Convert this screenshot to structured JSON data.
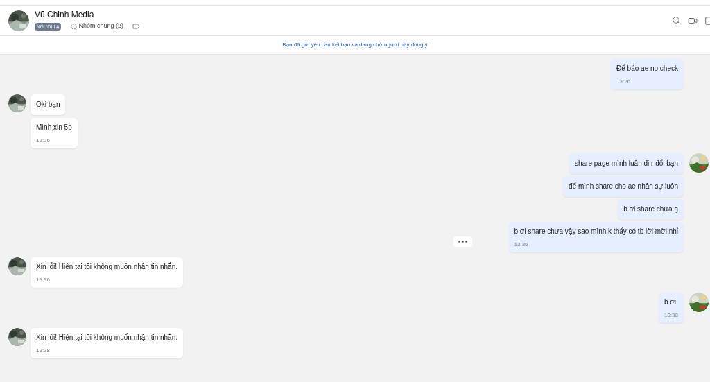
{
  "header": {
    "name": "Vũ Chinh Media",
    "badge": "NGƯỜI LẠ",
    "common_groups": "Nhóm chung (2)"
  },
  "notice": "Bạn đã gửi yêu cầu kết bạn và đang chờ người này đồng ý",
  "groups": [
    {
      "kind": "outgoing",
      "avatar": false,
      "bubbles": [
        {
          "text": "Để báo ae no check",
          "time": "13:26",
          "actions": false
        }
      ]
    },
    {
      "kind": "incoming",
      "avatar": true,
      "bubbles": [
        {
          "text": "Oki bạn",
          "actions": false
        },
        {
          "text": "Mình xin 5p",
          "time": "13:26",
          "actions": false
        }
      ]
    },
    {
      "kind": "outgoing",
      "avatar": true,
      "bubbles": [
        {
          "text": "share page mình luân đi r đổi bạn",
          "actions": false
        },
        {
          "text": "để mình share cho ae nhân sự luôn",
          "actions": false
        },
        {
          "text": "b ơi share chưa ạ",
          "actions": false
        },
        {
          "text": "b ơi share chưa vậy sao mình k thấy có tb lời mời nhỉ",
          "time": "13:36",
          "actions": true
        }
      ]
    },
    {
      "kind": "incoming",
      "avatar": true,
      "bubbles": [
        {
          "text": "Xin lỗi! Hiện tại tôi không muốn nhận tin nhắn.",
          "time": "13:36",
          "actions": false
        }
      ]
    },
    {
      "kind": "outgoing",
      "avatar": true,
      "bubbles": [
        {
          "text": "b ơi",
          "time": "13:38",
          "actions": false
        }
      ]
    },
    {
      "kind": "incoming",
      "avatar": true,
      "bubbles": [
        {
          "text": "Xin lỗi! Hiện tại tôi không muốn nhận tin nhắn.",
          "time": "13:38",
          "actions": false
        }
      ]
    }
  ]
}
